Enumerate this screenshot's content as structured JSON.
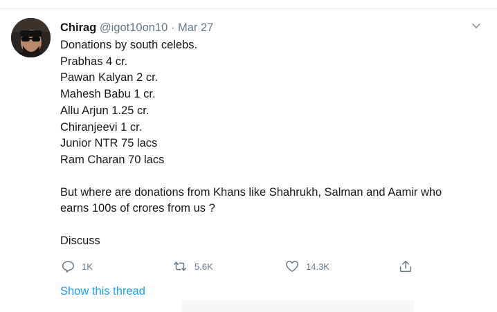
{
  "tweet": {
    "author_name": "Chirag",
    "author_handle": "@igot10on10",
    "separator": "·",
    "date": "Mar 27",
    "lines": [
      "Donations by south celebs.",
      "Prabhas 4 cr.",
      "Pawan Kalyan 2 cr.",
      "Mahesh Babu 1 cr.",
      "Allu Arjun 1.25 cr.",
      "Chiranjeevi 1 cr.",
      "Junior NTR 75 lacs",
      "Ram Charan 70 lacs"
    ],
    "question_lines": [
      "But where are donations from Khans like Shahrukh, Salman and Aamir who",
      "earns 100s of crores from us ?"
    ],
    "closing": "Discuss"
  },
  "actions": {
    "replies": "1K",
    "retweets": "5.6K",
    "likes": "14.3K"
  },
  "show_thread_label": "Show this thread",
  "icons": {
    "reply": "reply-icon",
    "retweet": "retweet-icon",
    "like": "heart-icon",
    "share": "share-icon",
    "more": "chevron-down-icon"
  },
  "colors": {
    "link": "#1da1f2",
    "muted": "#657786",
    "text": "#14171a"
  }
}
